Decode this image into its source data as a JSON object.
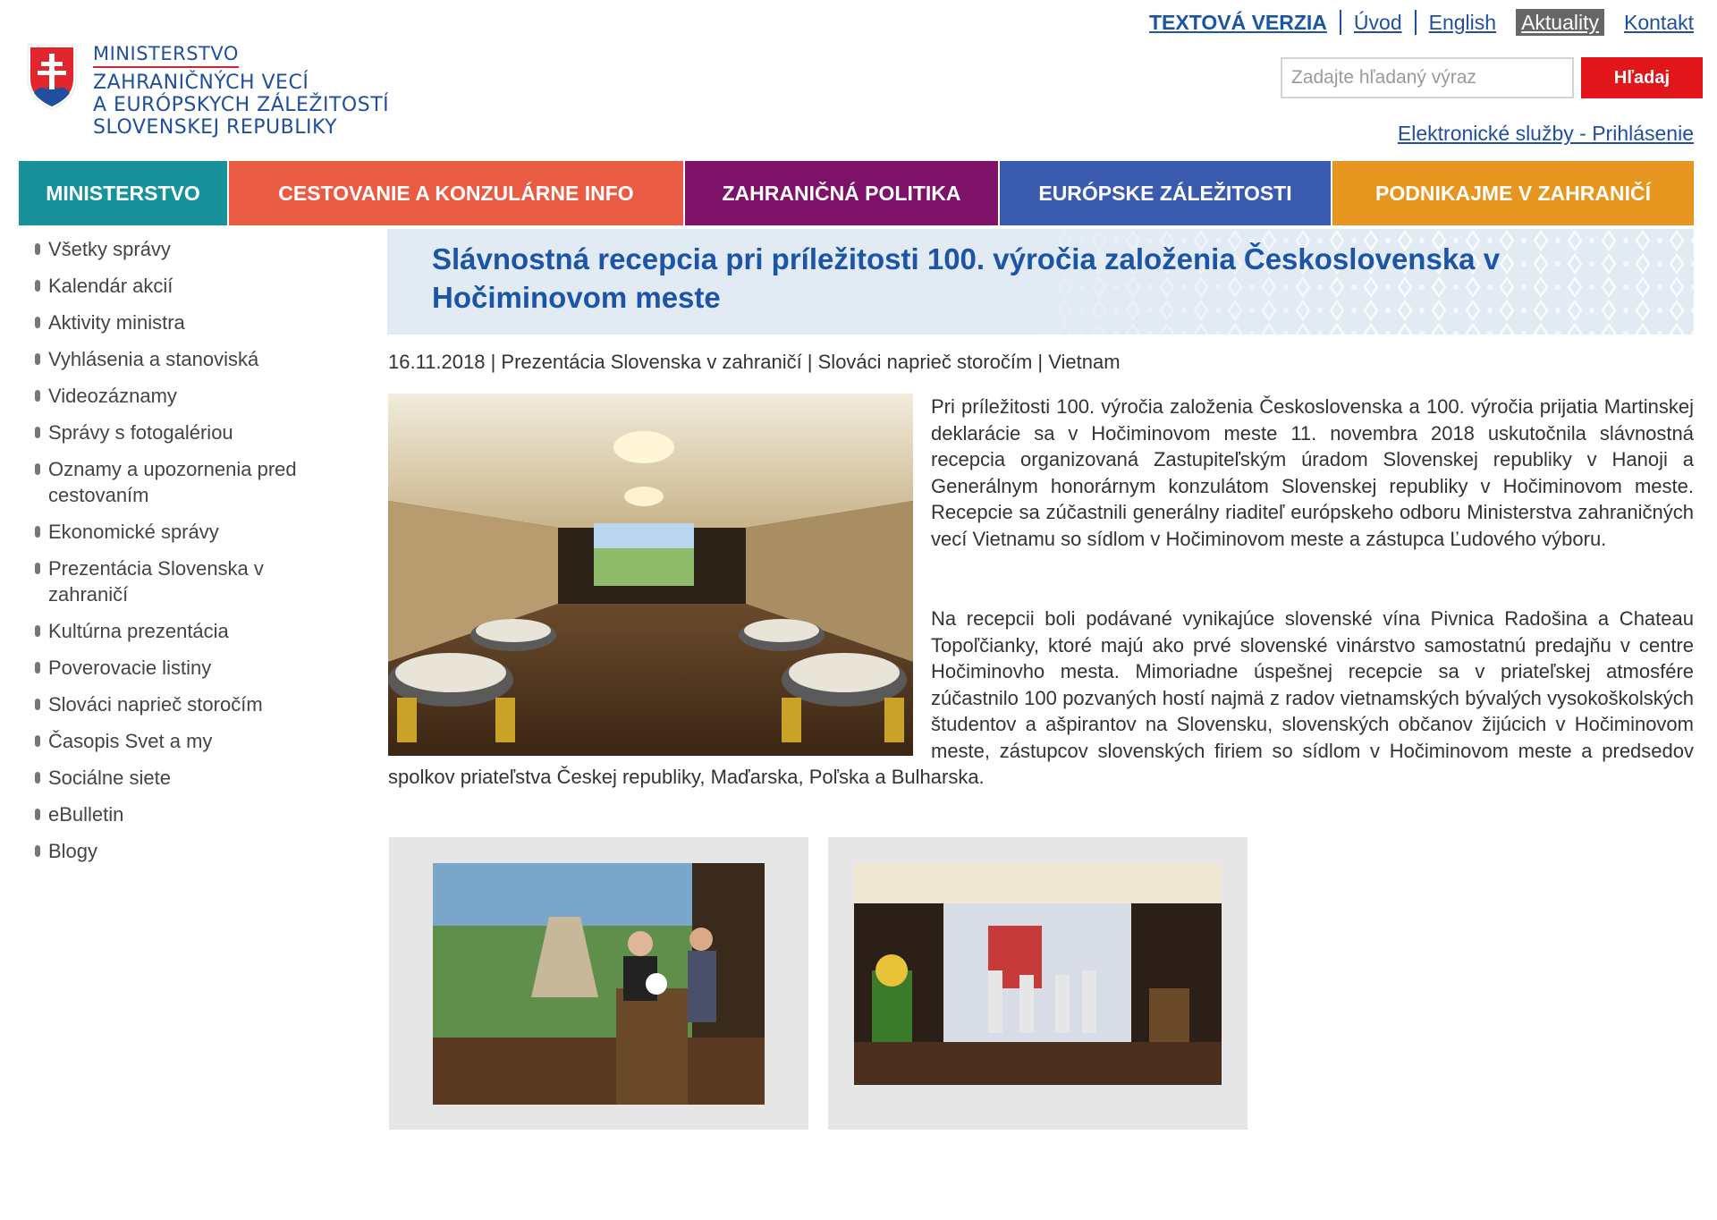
{
  "logo": {
    "lines": [
      "MINISTERSTVO",
      "ZAHRANIČNÝCH VECÍ",
      "A EURÓPSKYCH ZÁLEŽITOSTÍ",
      "SLOVENSKEJ REPUBLIKY"
    ],
    "icon": "slovak-coat-of-arms-icon"
  },
  "topnav": {
    "text_version": "TEXTOVÁ VERZIA",
    "home": "Úvod",
    "english": "English",
    "news": "Aktuality",
    "contact": "Kontakt"
  },
  "search": {
    "placeholder": "Zadajte hľadaný výraz",
    "button": "Hľadaj"
  },
  "eservices": "Elektronické služby - Prihlásenie",
  "mainnav": [
    {
      "label": "MINISTERSTVO",
      "color": "#17929b"
    },
    {
      "label": "CESTOVANIE A KONZULÁRNE INFO",
      "color": "#ea5b44"
    },
    {
      "label": "ZAHRANIČNÁ POLITIKA",
      "color": "#7d1268"
    },
    {
      "label": "EURÓPSKE ZÁLEŽITOSTI",
      "color": "#3a5aad"
    },
    {
      "label": "PODNIKAJME V ZAHRANIČÍ",
      "color": "#e6961f"
    }
  ],
  "sidebar": [
    "Všetky správy",
    "Kalendár akcií",
    "Aktivity ministra",
    "Vyhlásenia a stanoviská",
    "Videozáznamy",
    "Správy s fotogalériou",
    "Oznamy a upozornenia pred cestovaním",
    "Ekonomické správy",
    "Prezentácia Slovenska v zahraničí",
    "Kultúrna prezentácia",
    "Poverovacie listiny",
    "Slováci naprieč storočím",
    "Časopis Svet a my",
    "Sociálne siete",
    "eBulletin",
    "Blogy"
  ],
  "article": {
    "title": "Slávnostná recepcia pri príležitosti 100. výročia založenia Československa v Hočiminovom meste",
    "meta": "16.11.2018 | Prezentácia Slovenska v zahraničí | Slováci naprieč storočím | Vietnam",
    "paragraphs": [
      "Pri príležitosti 100. výročia založenia Československa a 100. výročia prijatia Martinskej deklarácie sa v Hočiminovom meste 11. novembra 2018 uskutočnila slávnostná recepcia organizovaná Zastupiteľským úradom Slovenskej republiky v Hanoji a Generálnym honorárnym konzulátom Slovenskej republiky v Hočiminovom meste. Recepcie sa zúčastnili generálny riaditeľ európskeho odboru Ministerstva zahraničných vecí Vietnamu so sídlom v Hočiminovom meste a zástupca Ľudového výboru.",
      "Na recepcii boli podávané vynikajúce slovenské vína Pivnica Radošina a Chateau Topoľčianky, ktoré majú ako prvé slovenské vinárstvo samostatnú predajňu v centre Hočiminovho mesta. Mimoriadne úspešnej recepcie sa v priateľskej atmosfére zúčastnilo 100 pozvaných hostí najmä z radov vietnamských bývalých vysokoškolských študentov a ašpirantov na Slovensku, slovenských občanov žijúcich v Hočiminovom meste, zástupcov slovenských firiem so sídlom v Hočiminovom meste a predsedov spolkov priateľstva Českej republiky, Maďarska, Poľska a Bulharska."
    ]
  }
}
